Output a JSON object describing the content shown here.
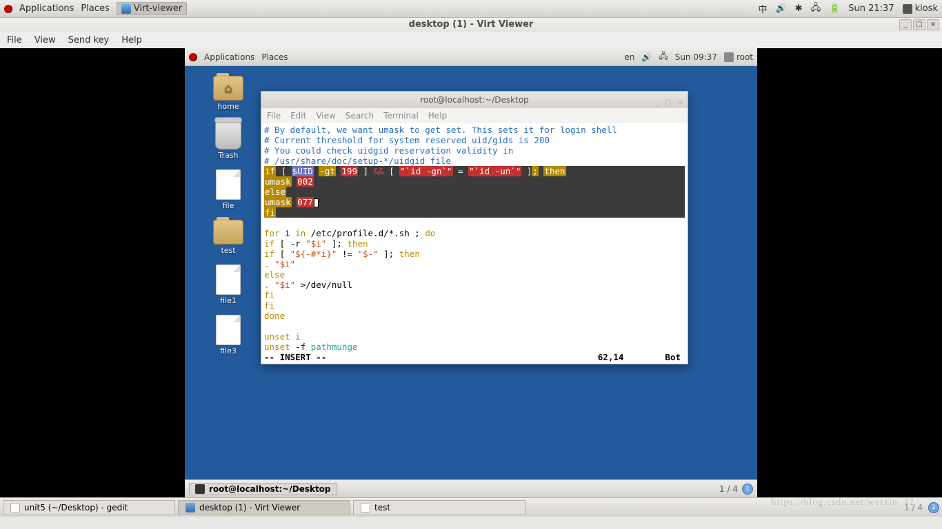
{
  "host": {
    "apps": "Applications",
    "places": "Places",
    "task": "Virt-viewer",
    "ime": "中",
    "clock": "Sun 21:37",
    "user": "kiosk"
  },
  "virt": {
    "title": "desktop (1) - Virt Viewer",
    "menu": [
      "File",
      "View",
      "Send key",
      "Help"
    ]
  },
  "inner": {
    "apps": "Applications",
    "places": "Places",
    "lang": "en",
    "clock": "Sun 09:37",
    "user": "root",
    "icons": [
      "home",
      "Trash",
      "file",
      "test",
      "file1",
      "file3"
    ],
    "bottom_task": "root@localhost:~/Desktop",
    "bottom_ws": "1 / 4"
  },
  "term": {
    "title": "root@localhost:~/Desktop",
    "menu": [
      "File",
      "Edit",
      "View",
      "Search",
      "Terminal",
      "Help"
    ],
    "cmt1": "# By default, we want umask to get set. This sets it for login shell",
    "cmt2": "# Current threshold for system reserved uid/gids is 200",
    "cmt3": "# You could check uidgid reservation validity in",
    "cmt4": "# /usr/share/doc/setup-*/uidgid file",
    "if_if": "if",
    "if_lb": "[",
    "if_uid": "$UID",
    "if_gt": "-gt",
    "if_199": "199",
    "if_rb": "]",
    "if_and": "&&",
    "if_lb2": "[",
    "if_idgn": "\"`id -gn`\"",
    "if_eq": "=",
    "if_idun": "\"`id -un`\"",
    "if_rb2": "]",
    "if_sc": ";",
    "if_then": "then",
    "umask1_k": "umask",
    "umask1_v": "002",
    "else": "else",
    "umask2_k": "umask",
    "umask2_v": "077",
    "fi": "fi",
    "for1": "for",
    "for2": "i",
    "for3": "in",
    "for4": "/etc/profile.d/*.sh ;",
    "for5": "do",
    "l2a": "if",
    "l2b": "[ -r",
    "l2c": "\"$i\"",
    "l2d": "];",
    "l2e": "then",
    "l3a": "if",
    "l3b": "[",
    "l3c": "\"${-#*i}\"",
    "l3d": "!=",
    "l3e": "\"$-\"",
    "l3f": "];",
    "l3g": "then",
    "l4a": ".",
    "l4b": "\"$i\"",
    "l5": "else",
    "l6a": ".",
    "l6b": "\"$i\"",
    "l6c": ">/dev/null",
    "l7": "fi",
    "l8": "fi",
    "done": "done",
    "u1a": "unset",
    "u1b": "i",
    "u2a": "unset",
    "u2b": "-f",
    "u2c": "pathmunge",
    "mode": "-- INSERT --",
    "pos": "62,14",
    "bot": "Bot"
  },
  "hostbar": {
    "t1": "unit5 (~/Desktop) - gedit",
    "t2": "desktop (1) - Virt Viewer",
    "t3": "test",
    "ws": "1 / 4",
    "watermark": "https://blog.csdn.net/weixin_42"
  }
}
